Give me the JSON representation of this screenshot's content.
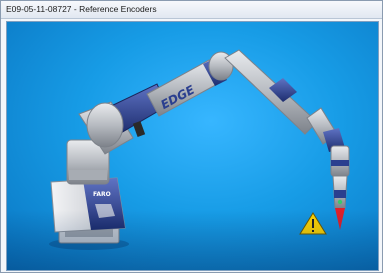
{
  "window": {
    "title": "E09-05-11-08727 - Reference Encoders"
  },
  "scene": {
    "arm_brand_label": "EDGE",
    "base_brand_label": "FARO",
    "warning_icon": "warning-triangle-icon",
    "colors": {
      "background": "#179ce6",
      "arm_gray": "#b9bcc2",
      "arm_blue": "#2b3f8f",
      "warning_yellow": "#ffd400",
      "probe_red": "#e0202a"
    }
  }
}
